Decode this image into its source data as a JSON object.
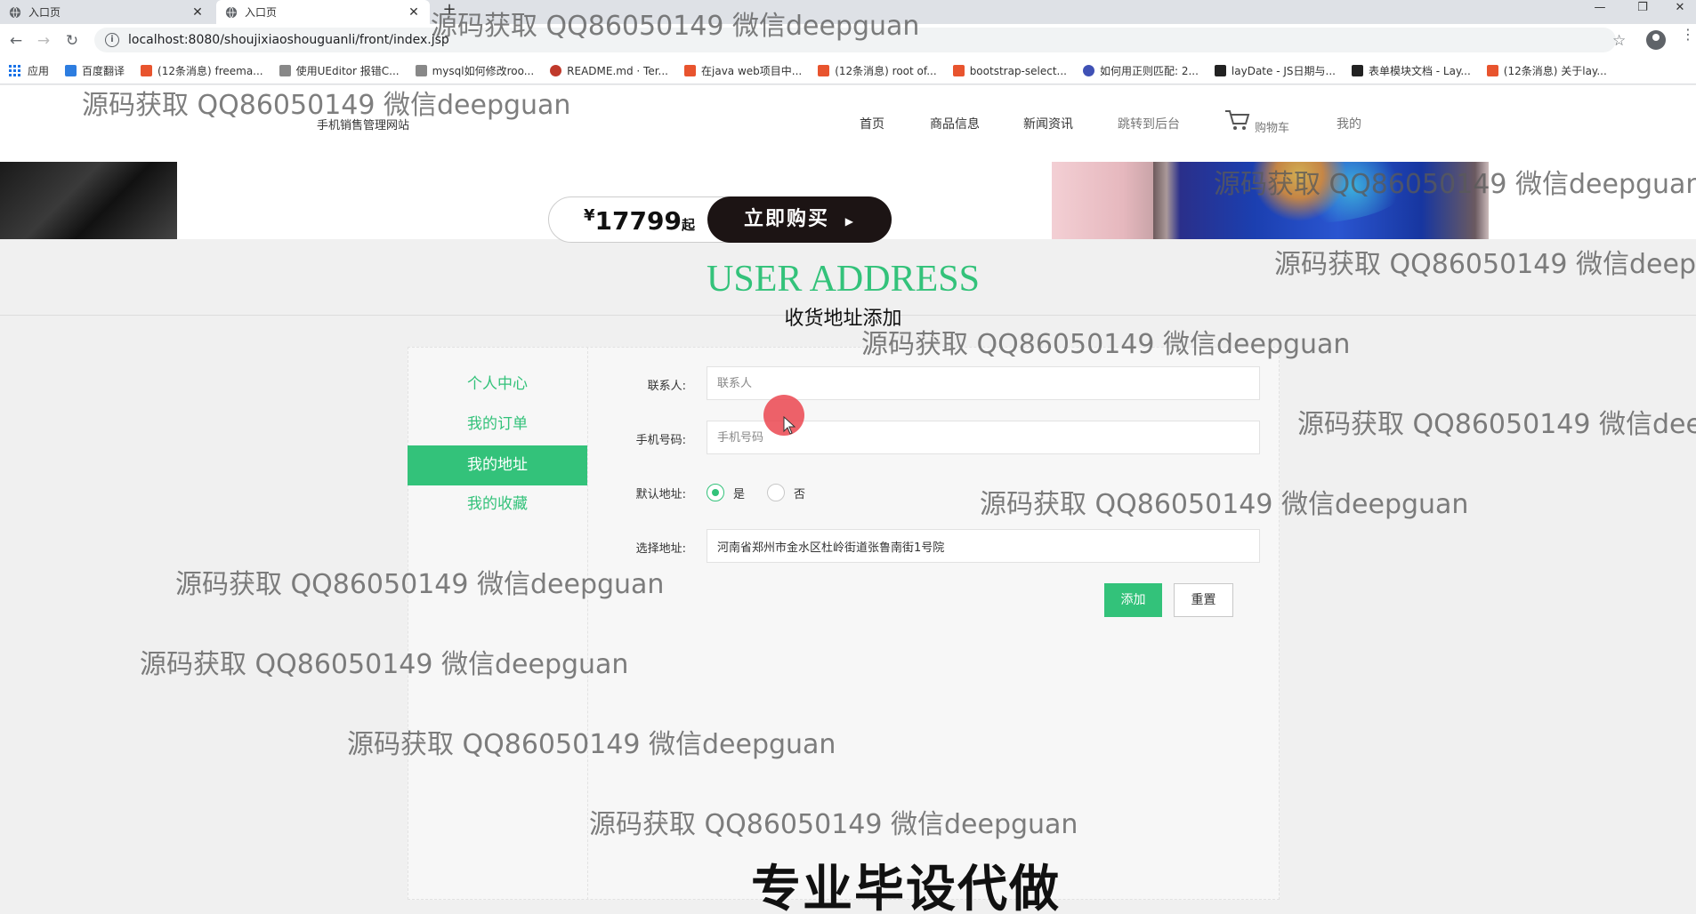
{
  "browser": {
    "tabs": [
      {
        "title": "入口页",
        "active": false
      },
      {
        "title": "入口页",
        "active": true
      }
    ],
    "new_tab": "+",
    "url": "localhost:8080/shoujixiaoshouguanli/front/index.jsp",
    "bookmarks": [
      {
        "label": "应用",
        "color": "#1a73e8"
      },
      {
        "label": "百度翻译",
        "color": "#2d7de0"
      },
      {
        "label": "(12条消息) freema...",
        "color": "#e8542e"
      },
      {
        "label": "使用UEditor 报错C...",
        "color": "#555555"
      },
      {
        "label": "mysql如何修改roo...",
        "color": "#555555"
      },
      {
        "label": "README.md · Ter...",
        "color": "#c0392b"
      },
      {
        "label": "在java web项目中...",
        "color": "#e8542e"
      },
      {
        "label": "(12条消息) root of...",
        "color": "#e8542e"
      },
      {
        "label": "bootstrap-select...",
        "color": "#e8542e"
      },
      {
        "label": "如何用正则匹配: 2...",
        "color": "#3f51b5"
      },
      {
        "label": "layDate - JS日期与...",
        "color": "#222222"
      },
      {
        "label": "表单模块文档 - Lay...",
        "color": "#222222"
      },
      {
        "label": "(12条消息) 关于lay...",
        "color": "#e8542e"
      }
    ]
  },
  "site": {
    "name": "手机销售管理网站",
    "nav": [
      "首页",
      "商品信息",
      "新闻资讯",
      "跳转到后台",
      "购物车",
      "我的"
    ]
  },
  "banner": {
    "price_symbol": "¥",
    "price": "17799",
    "price_suffix": "起",
    "buy_label": "立即购买"
  },
  "page": {
    "title_en": "USER ADDRESS",
    "title_cn": "收货地址添加"
  },
  "sidebar": {
    "items": [
      {
        "label": "个人中心",
        "active": false
      },
      {
        "label": "我的订单",
        "active": false
      },
      {
        "label": "我的地址",
        "active": true
      },
      {
        "label": "我的收藏",
        "active": false
      }
    ]
  },
  "form": {
    "contact_label": "联系人:",
    "contact_placeholder": "联系人",
    "phone_label": "手机号码:",
    "phone_placeholder": "手机号码",
    "default_label": "默认地址:",
    "default_yes": "是",
    "default_no": "否",
    "address_label": "选择地址:",
    "address_value": "河南省郑州市金水区杜岭街道张鲁南街1号院",
    "add_button": "添加",
    "reset_button": "重置"
  },
  "watermarks": {
    "text": "源码获取 QQ86050149 微信deepguan",
    "text_cut_a": "源码获取 QQ86050149 微信deepg",
    "text_cut_b": "源码获取 QQ86050149 微信dee",
    "slogan": "专业毕设代做"
  },
  "colors": {
    "accent": "#33c27a",
    "cursor": "#eb4650"
  }
}
